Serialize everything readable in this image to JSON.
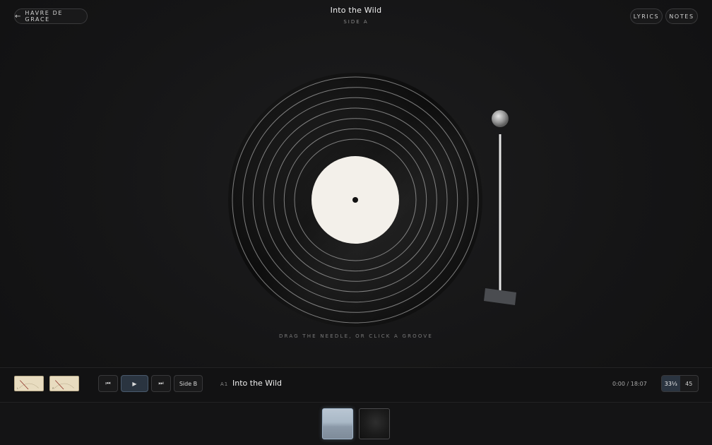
{
  "header": {
    "back_arrow": "←",
    "back_label": "HAVRE DE GRACE",
    "album_title": "Into the Wild",
    "side_label": "SIDE A",
    "lyrics_label": "LYRICS",
    "notes_label": "NOTES"
  },
  "turntable": {
    "hint": "DRAG THE NEEDLE, OR CLICK A GROOVE",
    "label_color": "#f3f0ea",
    "groove_count": 7
  },
  "controls": {
    "meter_left_label": "L",
    "meter_right_label": "R",
    "prev_icon": "⏮",
    "play_icon": "▶",
    "next_icon": "⏭",
    "side_button": "Side B",
    "track_number": "A1",
    "track_title": "Into the Wild",
    "time": "0:00 / 18:07",
    "speeds": [
      "33⅓",
      "45"
    ],
    "active_speed": "33⅓",
    "accent": "#2a3440"
  },
  "tray": {
    "thumbnails": [
      "side-a-cover",
      "side-b-cover"
    ]
  }
}
